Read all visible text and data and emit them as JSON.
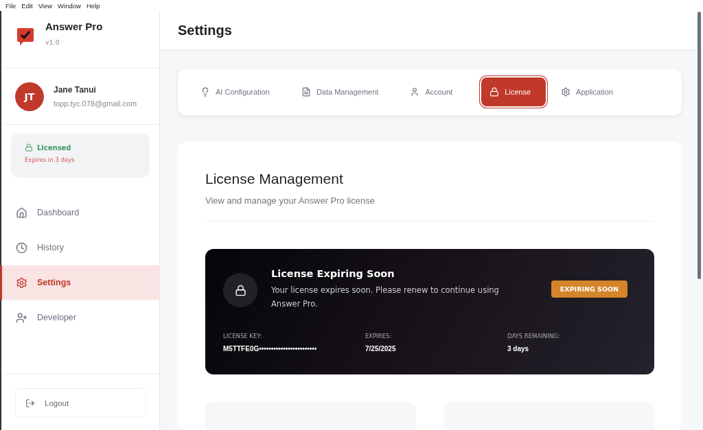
{
  "menu_bar": [
    "File",
    "Edit",
    "View",
    "Window",
    "Help"
  ],
  "app": {
    "name": "Answer Pro",
    "version": "v1.0"
  },
  "user": {
    "initials": "JT",
    "name": "Jane Tanui",
    "email": "topp.tyc.078@gmail.com"
  },
  "license_status": {
    "label": "Licensed",
    "note": "Expires in 3 days"
  },
  "nav": [
    {
      "kind": "home",
      "label": "Dashboard",
      "selected": false
    },
    {
      "kind": "clock",
      "label": "History",
      "selected": false
    },
    {
      "kind": "gear",
      "label": "Settings",
      "selected": true
    },
    {
      "kind": "user-plus",
      "label": "Developer",
      "selected": false
    }
  ],
  "logout": "Logout",
  "page_title": "Settings",
  "tabs": [
    {
      "kind": "bulb",
      "label": "AI Configuration",
      "selected": false
    },
    {
      "kind": "file",
      "label": "Data Management",
      "selected": false
    },
    {
      "kind": "user",
      "label": "Account",
      "selected": false
    },
    {
      "kind": "lock",
      "label": "License",
      "selected": true
    },
    {
      "kind": "gear",
      "label": "Application",
      "selected": false
    }
  ],
  "section": {
    "title": "License Management",
    "subtitle": "View and manage your Answer Pro license"
  },
  "license_card": {
    "title": "License Expiring Soon",
    "message": "Your license expires soon. Please renew to continue using Answer Pro.",
    "badge": "EXPIRING SOON",
    "fields": [
      {
        "label": "LICENSE KEY:",
        "value": "M5TTFE0G••••••••••••••••••••••••"
      },
      {
        "label": "EXPIRES:",
        "value": "7/25/2025"
      },
      {
        "label": "DAYS REMAINING:",
        "value": "3 days"
      }
    ]
  }
}
